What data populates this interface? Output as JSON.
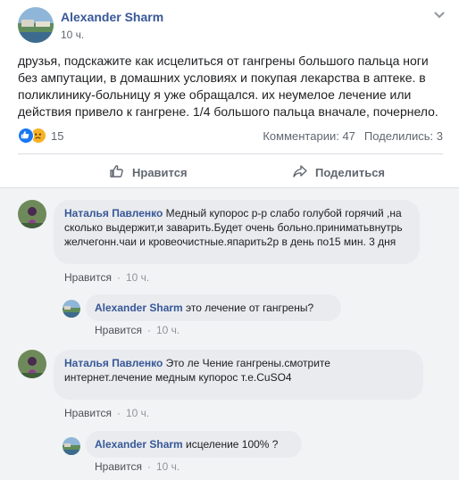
{
  "post": {
    "author": "Alexander Sharm",
    "time": "10 ч.",
    "text": "друзья, подскажите как исцелиться от гангрены большого пальца ноги без ампутации, в домашних условиях и покупая лекарства в аптеке. в поликлинику-больницу я уже обращался. их неумелое лечение или действия привело к гангрене. 1/4 большого пальца вначале, почернело.",
    "reaction_count": "15",
    "comments_count": "Комментарии: 47",
    "shares_count": "Поделились: 3",
    "like_label": "Нравится",
    "share_label": "Поделиться"
  },
  "comments": [
    {
      "author": "Наталья Павленко",
      "text": " Медный купорос р-р слабо голубой горячий ,на сколько выдержит,и заварить.Будет очень больно.приниматьвнутрь желчегонн.чаи и кровеочистные.япарить2р в день по15 мин. 3 дня",
      "like": "Нравится",
      "time": "10 ч."
    },
    {
      "author": "Alexander Sharm",
      "text": " это лечение от гангрены?",
      "like": "Нравится",
      "time": "10 ч."
    },
    {
      "author": "Наталья Павленко",
      "text": " Это ле Чение гангрены.смотрите интернет.лечение медным купорос т.е.CuSO4",
      "like": "Нравится",
      "time": "10 ч."
    },
    {
      "author": "Alexander Sharm",
      "text": " исцеление 100% ?",
      "like": "Нравится",
      "time": "10 ч."
    }
  ],
  "colors": {
    "link_blue": "#385898",
    "like_blue": "#1877f2",
    "sad_yellow": "#f7b125",
    "meta_gray": "#90949c"
  },
  "icons": [
    "chevron-down-icon",
    "like-reaction-icon",
    "sad-reaction-icon",
    "thumbs-up-icon",
    "share-arrow-icon"
  ]
}
